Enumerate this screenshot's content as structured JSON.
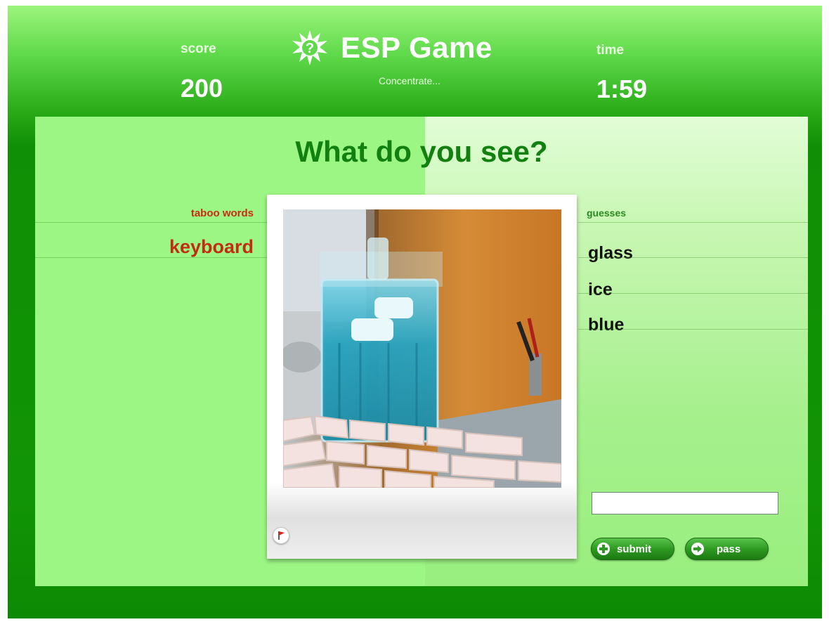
{
  "header": {
    "score_label": "score",
    "score_value": "200",
    "time_label": "time",
    "time_value": "1:59",
    "app_title": "ESP Game",
    "status_text": "Concentrate...",
    "logo_icon": "starburst-question-icon"
  },
  "main": {
    "prompt": "What do you see?",
    "taboo": {
      "label": "taboo words",
      "words": [
        "keyboard"
      ]
    },
    "guesses": {
      "label": "guesses",
      "items": [
        "glass",
        "ice",
        "blue"
      ]
    },
    "image": {
      "description_icon": "photo",
      "flag_icon": "red-flag-icon"
    },
    "input": {
      "value": "",
      "placeholder": ""
    },
    "buttons": {
      "submit_label": "submit",
      "submit_icon": "plus-icon",
      "pass_label": "pass",
      "pass_icon": "arrow-right-icon"
    }
  },
  "colors": {
    "frame_green": "#119405",
    "panel_green": "#9cf684",
    "title_green": "#12800f",
    "taboo_red": "#c92b14",
    "button_green": "#2e9a22"
  }
}
